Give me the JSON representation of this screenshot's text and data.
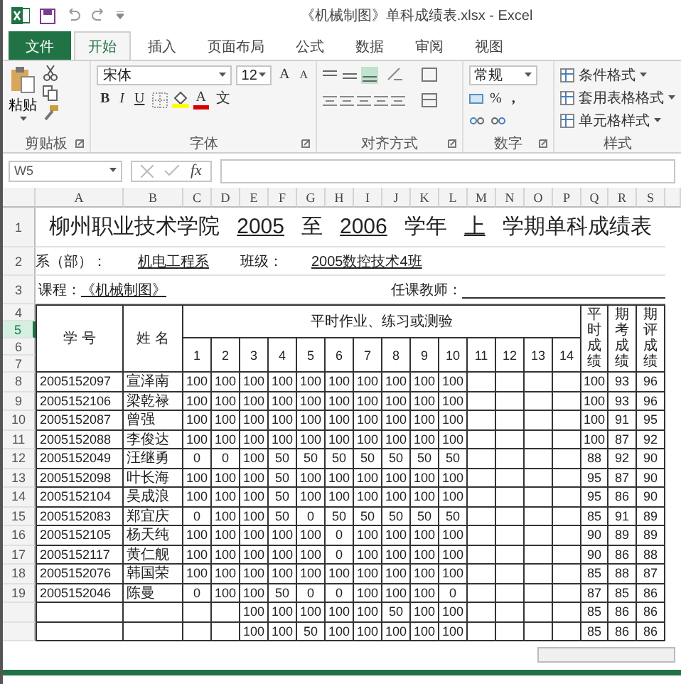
{
  "title_bar": {
    "title": "《机械制图》单科成绩表.xlsx - Excel"
  },
  "tabs": [
    {
      "label": "文件",
      "kind": "file",
      "selected": false
    },
    {
      "label": "开始",
      "kind": "tab",
      "selected": true
    },
    {
      "label": "插入",
      "kind": "tab",
      "selected": false
    },
    {
      "label": "页面布局",
      "kind": "tab",
      "selected": false
    },
    {
      "label": "公式",
      "kind": "tab",
      "selected": false
    },
    {
      "label": "数据",
      "kind": "tab",
      "selected": false
    },
    {
      "label": "审阅",
      "kind": "tab",
      "selected": false
    },
    {
      "label": "视图",
      "kind": "tab",
      "selected": false
    }
  ],
  "ribbon": {
    "clipboard": {
      "label": "剪贴板",
      "paste": "粘贴"
    },
    "font": {
      "label": "字体",
      "family": "宋体",
      "size": "12",
      "grow": "A",
      "shrink": "A",
      "bold": "B",
      "italic": "I",
      "underline": "U",
      "color_letter": "A",
      "phonetic": "文"
    },
    "alignment": {
      "label": "对齐方式"
    },
    "number": {
      "label": "数字",
      "format": "常规",
      "percent": "%",
      "comma": ","
    },
    "styles": {
      "label": "样式",
      "items": [
        "条件格式",
        "套用表格格式",
        "单元格样式"
      ]
    }
  },
  "formula_bar": {
    "name_box": "W5",
    "fx": "fx"
  },
  "sheet": {
    "columns": [
      "A",
      "B",
      "C",
      "D",
      "E",
      "F",
      "G",
      "H",
      "I",
      "J",
      "K",
      "L",
      "M",
      "N",
      "O",
      "P",
      "Q",
      "R",
      "S"
    ],
    "title_row": {
      "number": "1",
      "parts": [
        {
          "text": "柳州职业技术学院",
          "underline": false
        },
        {
          "text": "2005",
          "underline": true
        },
        {
          "text": "至",
          "underline": false
        },
        {
          "text": "2006",
          "underline": true
        },
        {
          "text": "学年",
          "underline": false
        },
        {
          "text": "上",
          "underline": true
        },
        {
          "text": "学期单科成绩表",
          "underline": false
        }
      ]
    },
    "info_row": {
      "number": "2",
      "dept_label": "系（部）：",
      "dept": "机电工程系",
      "class_label": "班级：",
      "class": "2005数控技术4班"
    },
    "course_row": {
      "number": "3",
      "course_label": "课程：",
      "course": "《机械制图》",
      "teacher_label": "任课教师："
    },
    "header": {
      "row_numbers": [
        {
          "number": "4",
          "selected": false
        },
        {
          "number": "5",
          "selected": true
        },
        {
          "number": "6",
          "selected": false
        },
        {
          "number": "7",
          "selected": false
        }
      ],
      "id": "学 号",
      "name": "姓 名",
      "group": "平时作业、练习或测验",
      "items": [
        "1",
        "2",
        "3",
        "4",
        "5",
        "6",
        "7",
        "8",
        "9",
        "10",
        "11",
        "12",
        "13",
        "14"
      ],
      "totals": [
        "平时成绩",
        "期考成绩",
        "期评成绩"
      ]
    },
    "rows": [
      {
        "number": "8",
        "id": "2005152097",
        "name": "宣泽南",
        "scores": [
          "100",
          "100",
          "100",
          "100",
          "100",
          "100",
          "100",
          "100",
          "100",
          "100"
        ],
        "usual": "100",
        "exam": "93",
        "final": "96"
      },
      {
        "number": "9",
        "id": "2005152106",
        "name": "梁乾禄",
        "scores": [
          "100",
          "100",
          "100",
          "100",
          "100",
          "100",
          "100",
          "100",
          "100",
          "100"
        ],
        "usual": "100",
        "exam": "93",
        "final": "96"
      },
      {
        "number": "10",
        "id": "2005152087",
        "name": "曾强",
        "scores": [
          "100",
          "100",
          "100",
          "100",
          "100",
          "100",
          "100",
          "100",
          "100",
          "100"
        ],
        "usual": "100",
        "exam": "91",
        "final": "95"
      },
      {
        "number": "11",
        "id": "2005152088",
        "name": "李俊达",
        "scores": [
          "100",
          "100",
          "100",
          "100",
          "100",
          "100",
          "100",
          "100",
          "100",
          "100"
        ],
        "usual": "100",
        "exam": "87",
        "final": "92"
      },
      {
        "number": "12",
        "id": "2005152049",
        "name": "汪继勇",
        "scores": [
          "0",
          "0",
          "100",
          "50",
          "50",
          "50",
          "50",
          "50",
          "50",
          "50"
        ],
        "usual": "88",
        "exam": "92",
        "final": "90"
      },
      {
        "number": "13",
        "id": "2005152098",
        "name": "叶长海",
        "scores": [
          "100",
          "100",
          "100",
          "50",
          "100",
          "100",
          "100",
          "100",
          "100",
          "100"
        ],
        "usual": "95",
        "exam": "87",
        "final": "90"
      },
      {
        "number": "14",
        "id": "2005152104",
        "name": "吴成浪",
        "scores": [
          "100",
          "100",
          "100",
          "50",
          "100",
          "100",
          "100",
          "100",
          "100",
          "100"
        ],
        "usual": "95",
        "exam": "86",
        "final": "90"
      },
      {
        "number": "15",
        "id": "2005152083",
        "name": "郑宜庆",
        "scores": [
          "0",
          "100",
          "100",
          "50",
          "0",
          "50",
          "50",
          "50",
          "50",
          "50"
        ],
        "usual": "85",
        "exam": "91",
        "final": "89"
      },
      {
        "number": "16",
        "id": "2005152105",
        "name": "杨天纯",
        "scores": [
          "100",
          "100",
          "100",
          "100",
          "100",
          "0",
          "100",
          "100",
          "100",
          "100"
        ],
        "usual": "90",
        "exam": "89",
        "final": "89"
      },
      {
        "number": "17",
        "id": "2005152117",
        "name": "黄仁舰",
        "scores": [
          "100",
          "100",
          "100",
          "100",
          "100",
          "0",
          "100",
          "100",
          "100",
          "100"
        ],
        "usual": "90",
        "exam": "86",
        "final": "88"
      },
      {
        "number": "18",
        "id": "2005152076",
        "name": "韩国荣",
        "scores": [
          "100",
          "100",
          "100",
          "100",
          "100",
          "100",
          "100",
          "100",
          "100",
          "100"
        ],
        "usual": "85",
        "exam": "88",
        "final": "87"
      },
      {
        "number": "19",
        "id": "2005152046",
        "name": "陈曼",
        "scores": [
          "0",
          "100",
          "100",
          "50",
          "0",
          "0",
          "100",
          "100",
          "100",
          "0"
        ],
        "usual": "87",
        "exam": "85",
        "final": "86"
      },
      {
        "kind": "partial",
        "scores": [
          "100",
          "100",
          "100",
          "100",
          "100",
          "50",
          "100",
          "100"
        ],
        "usual": "85",
        "exam": "86",
        "final": "86"
      },
      {
        "kind": "partial",
        "scores": [
          "100",
          "100",
          "50",
          "100",
          "100",
          "100",
          "100",
          "100"
        ],
        "usual": "85",
        "exam": "86",
        "final": "86"
      }
    ]
  }
}
